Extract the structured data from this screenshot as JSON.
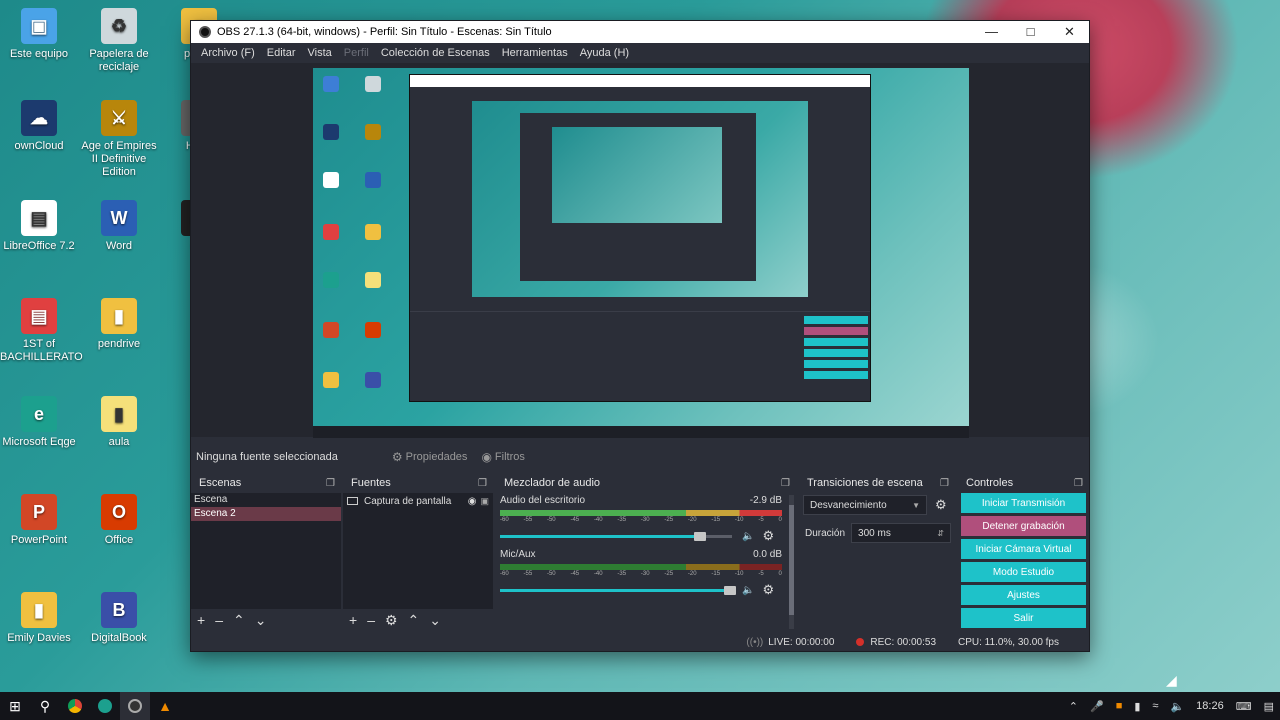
{
  "desktop": {
    "icons": [
      {
        "label": "Este equipo",
        "icon": "computer-icon",
        "color": "#4aa3e8"
      },
      {
        "label": "Papelera de reciclaje",
        "icon": "recycle-bin-icon",
        "color": "#cfd8dc"
      },
      {
        "label": "power",
        "icon": "folder-icon",
        "color": "#f0c040"
      },
      {
        "label": "ownCloud",
        "icon": "owncloud-icon",
        "color": "#1c3a6e"
      },
      {
        "label": "Age of Empires II Definitive Edition",
        "icon": "aoe-icon",
        "color": "#b8860b"
      },
      {
        "label": "Hu M",
        "icon": "app-icon",
        "color": "#666666"
      },
      {
        "label": "LibreOffice 7.2",
        "icon": "document-icon",
        "color": "#ffffff"
      },
      {
        "label": "Word",
        "icon": "word-icon",
        "color": "#2b5fb4"
      },
      {
        "label": "OB",
        "icon": "obs-icon",
        "color": "#222222"
      },
      {
        "label": "1ST of BACHILLERATO",
        "icon": "pdf-icon",
        "color": "#e04040"
      },
      {
        "label": "pendrive",
        "icon": "folder-icon",
        "color": "#f0c040"
      },
      {
        "label": "Microsoft Eqge",
        "icon": "edge-icon",
        "color": "#1ca08e"
      },
      {
        "label": "aula",
        "icon": "folder-icon",
        "color": "#f5e07a"
      },
      {
        "label": "PowerPoint",
        "icon": "powerpoint-icon",
        "color": "#d24726"
      },
      {
        "label": "Office",
        "icon": "office-icon",
        "color": "#d83b01"
      },
      {
        "label": "Emily Davies",
        "icon": "user-folder-icon",
        "color": "#f0c040"
      },
      {
        "label": "DigitalBook",
        "icon": "digitalbook-icon",
        "color": "#3a4fa8"
      }
    ]
  },
  "obs": {
    "title": "OBS 27.1.3 (64-bit, windows) - Perfil: Sin Título - Escenas: Sin Título",
    "menu": [
      "Archivo (F)",
      "Editar",
      "Vista",
      "Perfil",
      "Colección de Escenas",
      "Herramientas",
      "Ayuda (H)"
    ],
    "source_bar": {
      "no_source": "Ninguna fuente seleccionada",
      "properties": "Propiedades",
      "filters": "Filtros"
    },
    "scenes": {
      "title": "Escenas",
      "items": [
        "Escena",
        "Escena 2"
      ],
      "selected_index": 1
    },
    "sources": {
      "title": "Fuentes",
      "items": [
        "Captura de pantalla"
      ]
    },
    "mixer": {
      "title": "Mezclador de audio",
      "ticks": [
        "-60",
        "-55",
        "-50",
        "-45",
        "-40",
        "-35",
        "-30",
        "-25",
        "-20",
        "-15",
        "-10",
        "-5",
        "0"
      ],
      "channels": [
        {
          "name": "Audio del escritorio",
          "db": "-2.9 dB",
          "volume": 0.86
        },
        {
          "name": "Mic/Aux",
          "db": "0.0 dB",
          "volume": 0.99
        }
      ]
    },
    "transitions": {
      "title": "Transiciones de escena",
      "selected": "Desvanecimiento",
      "duration_label": "Duración",
      "duration_value": "300 ms"
    },
    "controls": {
      "title": "Controles",
      "buttons": [
        "Iniciar Transmisión",
        "Detener grabación",
        "Iniciar Cámara Virtual",
        "Modo Estudio",
        "Ajustes",
        "Salir"
      ]
    },
    "status": {
      "live": "LIVE: 00:00:00",
      "rec": "REC: 00:00:53",
      "cpu": "CPU: 11.0%, 30.00 fps"
    }
  },
  "taskbar": {
    "time": "18:26"
  },
  "colors": {
    "accent": "#1ec2c9",
    "recording": "#b04f7c",
    "selected_scene": "#6a3a48"
  }
}
